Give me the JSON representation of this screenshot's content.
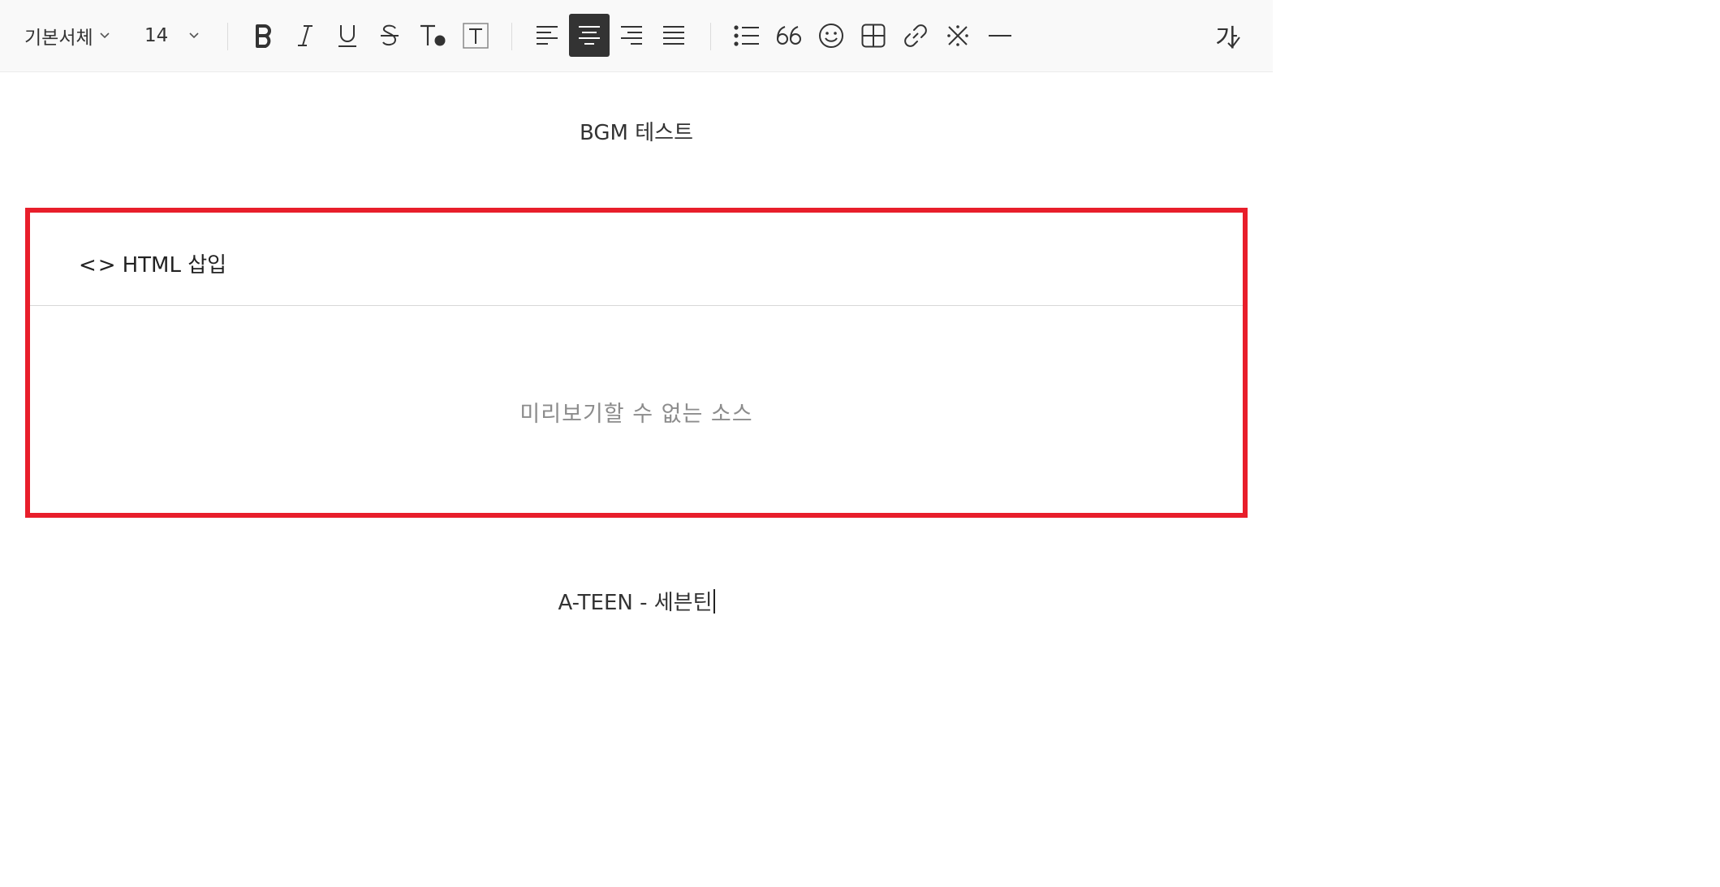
{
  "toolbar": {
    "font_family_value": "기본서체",
    "font_size_value": "14",
    "spellcheck_label": "가"
  },
  "document": {
    "line1": "BGM 테스트",
    "html_block": {
      "header_glyph": "<>",
      "header_label": "HTML 삽입",
      "preview_message": "미리보기할 수 없는 소스"
    },
    "line2": "A-TEEN - 세븐틴"
  },
  "colors": {
    "highlight_border": "#e81e2b",
    "active_button_bg": "#333333"
  }
}
